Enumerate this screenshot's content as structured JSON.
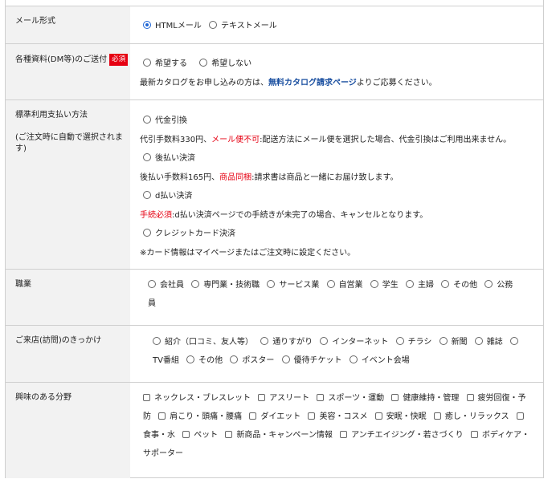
{
  "mail_format": {
    "label": "メール形式",
    "options": [
      "HTMLメール",
      "テキストメール"
    ],
    "selected": "HTMLメール"
  },
  "dm": {
    "label": "各種資料(DM等)のご送付",
    "badge": "必須",
    "options": [
      "希望する",
      "希望しない"
    ],
    "note_prefix": "最新カタログをお申し込みの方は、",
    "note_link": "無料カタログ請求ページ",
    "note_suffix": "よりご応募ください。"
  },
  "payment": {
    "label": "標準利用支払い方法",
    "sublabel": "(ご注文時に自動で選択されます)",
    "cod": "代金引換",
    "cod_note_a": "代引手数料330円、",
    "cod_note_red": "メール便不可",
    "cod_note_b": ":配送方法にメール便を選択した場合、代金引換はご利用出来ません。",
    "deferred": "後払い決済",
    "deferred_note_a": "後払い手数料165円、",
    "deferred_note_red": "商品同梱",
    "deferred_note_b": ":請求書は商品と一緒にお届け致します。",
    "dpay": "d払い決済",
    "dpay_note_red": "手続必須",
    "dpay_note_b": ":d払い決済ページでの手続きが未完了の場合、キャンセルとなります。",
    "card": "クレジットカード決済",
    "card_note": "※カード情報はマイページまたはご注文時に設定ください。"
  },
  "occupation": {
    "label": "職業",
    "options": [
      "会社員",
      "専門業・技術職",
      "サービス業",
      "自営業",
      "学生",
      "主婦",
      "その他",
      "公務員"
    ]
  },
  "visit": {
    "label": "ご来店(訪問)のきっかけ",
    "options": [
      "紹介（口コミ、友人等）",
      "通りすがり",
      "インターネット",
      "チラシ",
      "新聞",
      "雑誌",
      "TV番組",
      "その他",
      "ポスター",
      "優待チケット",
      "イベント会場"
    ]
  },
  "interests": {
    "label": "興味のある分野",
    "options": [
      "ネックレス・ブレスレット",
      "アスリート",
      "スポーツ・運動",
      "健康維持・管理",
      "疲労回復・予防",
      "肩こり・頭痛・腰痛",
      "ダイエット",
      "美容・コスメ",
      "安眠・快眠",
      "癒し・リラックス",
      "食事・水",
      "ペット",
      "新商品・キャンペーン情報",
      "アンチエイジング・若さづくり",
      "ボディケア・サポーター"
    ]
  }
}
